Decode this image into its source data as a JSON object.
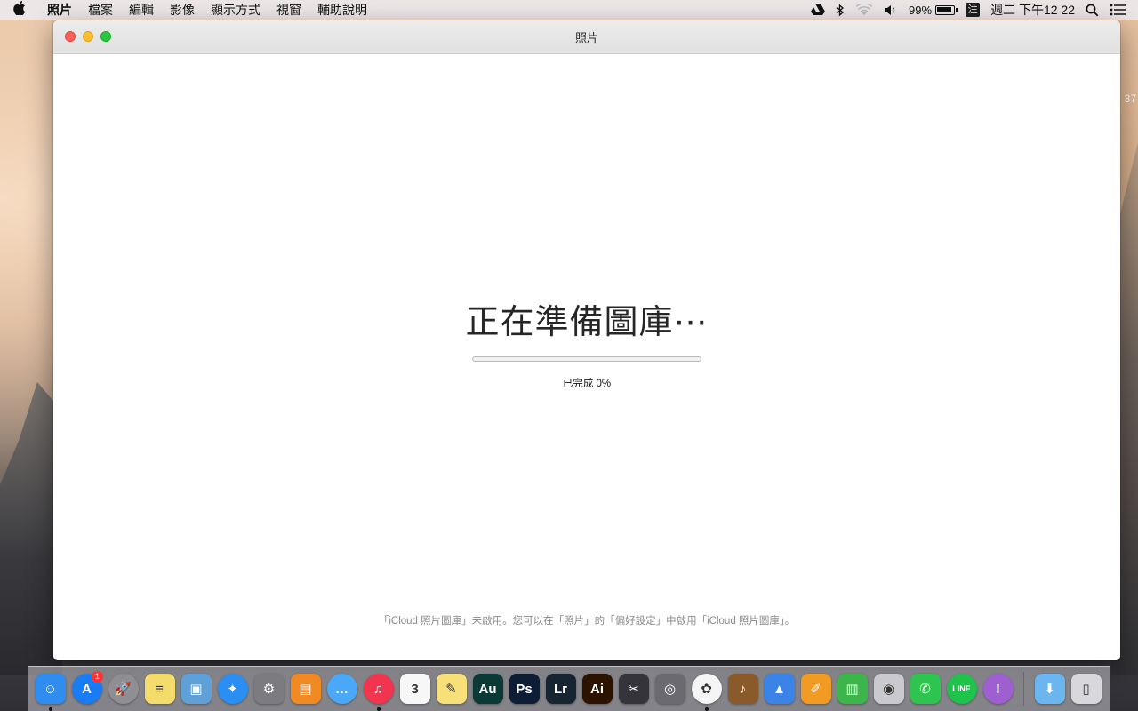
{
  "menubar": {
    "apple_icon": "apple-icon",
    "items": [
      "照片",
      "檔案",
      "編輯",
      "影像",
      "顯示方式",
      "視窗",
      "輔助說明"
    ],
    "status": {
      "battery_percent": "99%",
      "ime_label": "注",
      "clock": "週二 下午12 22"
    }
  },
  "desktop": {
    "edge_number": "37"
  },
  "window": {
    "title": "照片",
    "heading": "正在準備圖庫⋯",
    "progress_fraction": 0,
    "progress_label": "已完成 0%",
    "footer_note": "「iCloud 照片圖庫」未啟用。您可以在「照片」的「偏好設定」中啟用「iCloud 照片圖庫」。"
  },
  "dock": {
    "apps": [
      {
        "name": "finder-icon",
        "glyph": "☺",
        "color": "#2f8df0",
        "running": true
      },
      {
        "name": "app-store-icon",
        "glyph": "A",
        "color": "#1a7cf5",
        "badge": "1"
      },
      {
        "name": "launchpad-icon",
        "glyph": "🚀",
        "color": "#8e8e93"
      },
      {
        "name": "stickies-icon",
        "glyph": "≡",
        "color": "#f4dc6c"
      },
      {
        "name": "preview-icon",
        "glyph": "▣",
        "color": "#5fa0d6"
      },
      {
        "name": "safari-icon",
        "glyph": "✦",
        "color": "#2a8ef2"
      },
      {
        "name": "system-preferences-icon",
        "glyph": "⚙",
        "color": "#7c7c80"
      },
      {
        "name": "ibooks-icon",
        "glyph": "▤",
        "color": "#f08a24"
      },
      {
        "name": "messages-icon",
        "glyph": "…",
        "color": "#4aa8f6"
      },
      {
        "name": "itunes-icon",
        "glyph": "♫",
        "color": "#f2344f",
        "running": true
      },
      {
        "name": "calendar-icon",
        "glyph": "3",
        "color": "#f7f7f7"
      },
      {
        "name": "notes-icon",
        "glyph": "✎",
        "color": "#f7e07a"
      },
      {
        "name": "audition-icon",
        "glyph": "Au",
        "color": "#0b3a36"
      },
      {
        "name": "photoshop-icon",
        "glyph": "Ps",
        "color": "#0d1d35"
      },
      {
        "name": "lightroom-icon",
        "glyph": "Lr",
        "color": "#172532"
      },
      {
        "name": "illustrator-icon",
        "glyph": "Ai",
        "color": "#2b1300"
      },
      {
        "name": "final-cut-pro-icon",
        "glyph": "✂",
        "color": "#34343a"
      },
      {
        "name": "motion-icon",
        "glyph": "◎",
        "color": "#6a6a70"
      },
      {
        "name": "photos-icon",
        "glyph": "✿",
        "color": "#f5f5f5",
        "running": true
      },
      {
        "name": "garageband-icon",
        "glyph": "♪",
        "color": "#8a5a2a"
      },
      {
        "name": "keynote-icon",
        "glyph": "▲",
        "color": "#3b83e6"
      },
      {
        "name": "pages-icon",
        "glyph": "✐",
        "color": "#f19a24"
      },
      {
        "name": "numbers-icon",
        "glyph": "▥",
        "color": "#3cb54a"
      },
      {
        "name": "photo-booth-icon",
        "glyph": "◉",
        "color": "#c9c9cf"
      },
      {
        "name": "facetime-icon",
        "glyph": "✆",
        "color": "#2fc34f"
      },
      {
        "name": "line-icon",
        "glyph": "LINE",
        "color": "#1fc24a"
      },
      {
        "name": "alert-app-icon",
        "glyph": "!",
        "color": "#a05fd1"
      }
    ],
    "right_items": [
      {
        "name": "downloads-folder-icon",
        "glyph": "⬇",
        "color": "#6bb6ef"
      },
      {
        "name": "trash-icon",
        "glyph": "▯",
        "color": "#d8d8dc"
      }
    ]
  }
}
